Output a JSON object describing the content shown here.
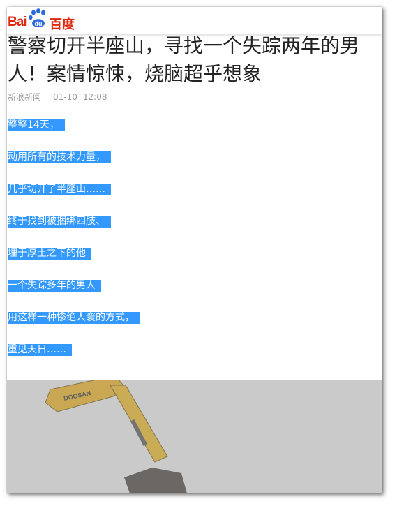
{
  "header": {
    "logo_text_latin": "Bai",
    "logo_paw_text": "du",
    "logo_text_cn": "百度",
    "brand_color": "#de2910"
  },
  "article": {
    "title": "警察切开半座山，寻找一个失踪两年的男人！案情惊悚，烧脑超乎想象",
    "source": "新浪新闻",
    "date": "01-10",
    "time": "12:08",
    "selection_color": "#3399ff",
    "lines": [
      "整整14天，",
      "动用所有的技术力量，",
      "几乎切开了半座山……",
      "终于找到被捆绑四肢、",
      "埋于厚土之下的他",
      "一个失踪多年的男人",
      "用这样一种惨绝人寰的方式，",
      "重见天日……"
    ]
  },
  "image": {
    "caption_visible": "",
    "boom_text": "DOOSAN"
  }
}
